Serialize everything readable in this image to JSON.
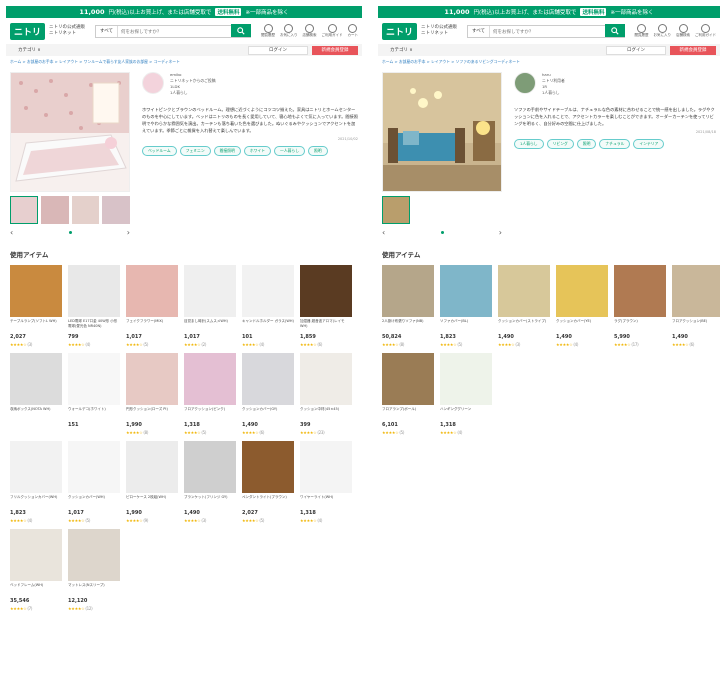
{
  "banner": {
    "amount": "11,000",
    "text1": "円(税込)以上お買上げ、または店舗受取で",
    "free": "送料無料",
    "text2": "※一部商品を除く"
  },
  "header": {
    "logo": "ニトリ",
    "brand1": "ニトリの公式通販",
    "brand2": "ニトリネット",
    "search_category": "すべて",
    "search_placeholder": "何をお探しですか？",
    "icons": [
      "閲覧履歴",
      "お気に入り",
      "店舗検索",
      "ご利用ガイド",
      "カート"
    ]
  },
  "subbar": {
    "category": "カテゴリ",
    "login": "ログイン",
    "register": "新規会員登録"
  },
  "section_title": "使用アイテム",
  "left": {
    "crumb": "ホーム > お部屋のお手本 > レイアウト > ワンルームで暮らす友人家族のお部屋 > コーディネート",
    "user": {
      "name": "emiko",
      "line2": "ニトリネットからのご投稿",
      "line3": "1LDK",
      "line4": "1人暮らし"
    },
    "description": "ホワイトピンクとブラウンのベッドルーム。理想に近づくようにコツコツ揃えた。家具はニトリとホームセンターのものを中心にしています。ベッドはニトリのものを長く愛用していて、寝心地もよくて気に入っています。間接照明でやわらかな雰囲気を演出。カーテンも落ち着いた色を選びました。ぬいぐるみやクッションでアクセントを加えています。季節ごとに雑貨を入れ替えて楽しんでいます。",
    "date": "2021/10/02",
    "tags": [
      "ベッドルーム",
      "フェミニン",
      "間接照明",
      "ホワイト",
      "一人暮らし",
      "照明"
    ],
    "items": [
      {
        "name": "テーブルランプ(ソフトL WH)",
        "price": "2,027",
        "rating": "★★★★☆",
        "count": "(3)"
      },
      {
        "name": "LED電球 E17口金 40W形 小形電球(昼光色 NR40N)",
        "price": "799",
        "rating": "★★★★☆",
        "count": "(4)"
      },
      {
        "name": "フェイクフラワー(MIX)",
        "price": "1,017",
        "rating": "★★★★☆",
        "count": "(5)"
      },
      {
        "name": "目覚まし時計(スムスメWH)",
        "price": "1,017",
        "rating": "★★★★☆",
        "count": "(2)"
      },
      {
        "name": "キャンドルホルダー ガラス(WH)",
        "price": "101",
        "rating": "★★★★☆",
        "count": "(4)"
      },
      {
        "name": "加湿器 超音波アロマ(レイモ WH)",
        "price": "1,859",
        "rating": "★★★★☆",
        "count": "(6)"
      },
      {
        "name": "収納ボックス(NOTA WH)",
        "price": "",
        "rating": "",
        "count": ""
      },
      {
        "name": "ウォールデコ(ホワイト)",
        "price": "151",
        "rating": "",
        "count": ""
      },
      {
        "name": "円形クッション(ローズ PI)",
        "price": "1,990",
        "rating": "★★★★☆",
        "count": "(8)"
      },
      {
        "name": "フロアクッション(ピンク)",
        "price": "1,318",
        "rating": "★★★★☆",
        "count": "(5)"
      },
      {
        "name": "クッションカバー(GY)",
        "price": "1,490",
        "rating": "★★★★☆",
        "count": "(6)"
      },
      {
        "name": "クッション中材(45×45)",
        "price": "399",
        "rating": "★★★★☆",
        "count": "(23)"
      },
      {
        "name": "フリルクッションカバー(WH)",
        "price": "1,823",
        "rating": "★★★★☆",
        "count": "(4)"
      },
      {
        "name": "クッションカバー(WH)",
        "price": "1,017",
        "rating": "★★★★☆",
        "count": "(5)"
      },
      {
        "name": "ピローケース 2枚組(WH)",
        "price": "1,990",
        "rating": "★★★★☆",
        "count": "(9)"
      },
      {
        "name": "ブランケット(フリンジ GY)",
        "price": "1,490",
        "rating": "★★★★☆",
        "count": "(3)"
      },
      {
        "name": "ペンダントライト(ブラウン)",
        "price": "2,027",
        "rating": "★★★★☆",
        "count": "(5)"
      },
      {
        "name": "ワイヤーライト(WH)",
        "price": "1,318",
        "rating": "★★★★☆",
        "count": "(4)"
      },
      {
        "name": "ベッドフレーム(WH)",
        "price": "35,546",
        "rating": "★★★★☆",
        "count": "(7)"
      },
      {
        "name": "マットレス(Nスリープ)",
        "price": "12,120",
        "rating": "★★★★☆",
        "count": "(12)"
      }
    ]
  },
  "right": {
    "crumb": "ホーム > お部屋のお手本 > レイアウト > ソファのあるリビングコーディネート",
    "user": {
      "name": "haru",
      "line2": "ニトリ利用者",
      "line3": "1R",
      "line4": "1人暮らし"
    },
    "description": "ソファの手前やサイドテーブルは、ナチュラルな色の素材に合わせることで統一感を出しました。ラグやクッションに色を入れることで、アクセントカラーを楽しむことができます。オーダーカーテンを使ってリビングを明るく、自分好みの空間に仕上げました。",
    "date": "2021/08/18",
    "tags": [
      "1人暮らし",
      "リビング",
      "照明",
      "ナチュラル",
      "インテリア"
    ],
    "items": [
      {
        "name": "2人掛け布張りソファ(NB)",
        "price": "50,824",
        "rating": "★★★★☆",
        "count": "(8)"
      },
      {
        "name": "ソファカバー(BL)",
        "price": "1,823",
        "rating": "★★★★☆",
        "count": "(5)"
      },
      {
        "name": "クッションカバー(ストライプ)",
        "price": "1,490",
        "rating": "★★★★☆",
        "count": "(3)"
      },
      {
        "name": "クッションカバー(YE)",
        "price": "1,490",
        "rating": "★★★★☆",
        "count": "(4)"
      },
      {
        "name": "ラグ(ブラウン)",
        "price": "5,990",
        "rating": "★★★★☆",
        "count": "(17)"
      },
      {
        "name": "フロアクッション(BE)",
        "price": "1,490",
        "rating": "★★★★☆",
        "count": "(6)"
      },
      {
        "name": "フロアランプ(ボール)",
        "price": "6,101",
        "rating": "★★★★☆",
        "count": "(5)"
      },
      {
        "name": "ハンギンググリーン",
        "price": "1,318",
        "rating": "★★★★☆",
        "count": "(4)"
      }
    ]
  }
}
